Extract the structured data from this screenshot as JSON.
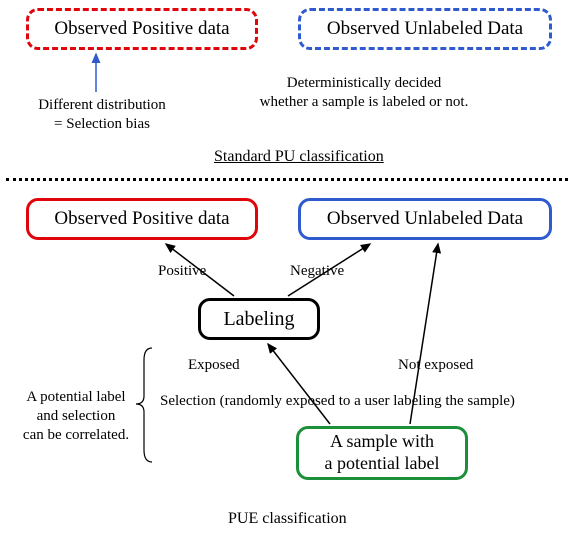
{
  "top": {
    "positive": "Observed Positive data",
    "unlabeled": "Observed Unlabeled Data",
    "left_note_l1": "Different distribution",
    "left_note_l2": "= Selection bias",
    "right_note_l1": "Deterministically decided",
    "right_note_l2": "whether a sample is labeled or not.",
    "section": "Standard PU classification"
  },
  "bottom": {
    "positive": "Observed Positive data",
    "unlabeled": "Observed Unlabeled Data",
    "positive_edge": "Positive",
    "negative_edge": "Negative",
    "labeling": "Labeling",
    "exposed": "Exposed",
    "not_exposed": "Not exposed",
    "selection_text": "Selection (randomly exposed to a user labeling the sample)",
    "left_note_l1": "A potential label",
    "left_note_l2": "and selection",
    "left_note_l3": "can be correlated.",
    "sample_l1": "A sample with",
    "sample_l2": "a potential label",
    "section": "PUE classification"
  }
}
